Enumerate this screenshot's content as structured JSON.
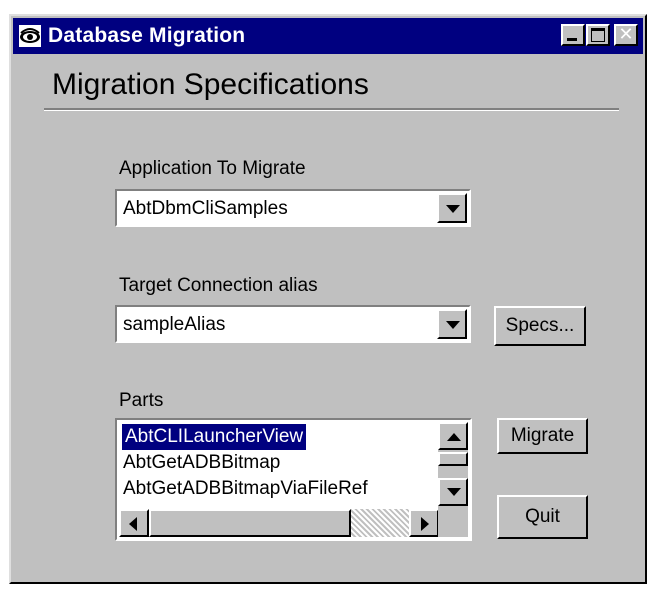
{
  "window": {
    "title": "Database Migration",
    "icon": "eye-icon",
    "minimize_icon": "minimize-icon",
    "maximize_icon": "maximize-icon",
    "close_label": "✕"
  },
  "heading": "Migration Specifications",
  "application": {
    "label": "Application To Migrate",
    "value": "AbtDbmCliSamples"
  },
  "target": {
    "label": "Target Connection alias",
    "value": "sampleAlias"
  },
  "specs_button": "Specs...",
  "parts": {
    "label": "Parts",
    "items": [
      "AbtCLILauncherView",
      "AbtGetADBBitmap",
      "AbtGetADBBitmapViaFileRef"
    ],
    "selected_index": 0
  },
  "migrate_button": "Migrate",
  "quit_button": "Quit",
  "colors": {
    "titlebar": "#000080",
    "face": "#c0c0c0",
    "selection": "#000080"
  }
}
